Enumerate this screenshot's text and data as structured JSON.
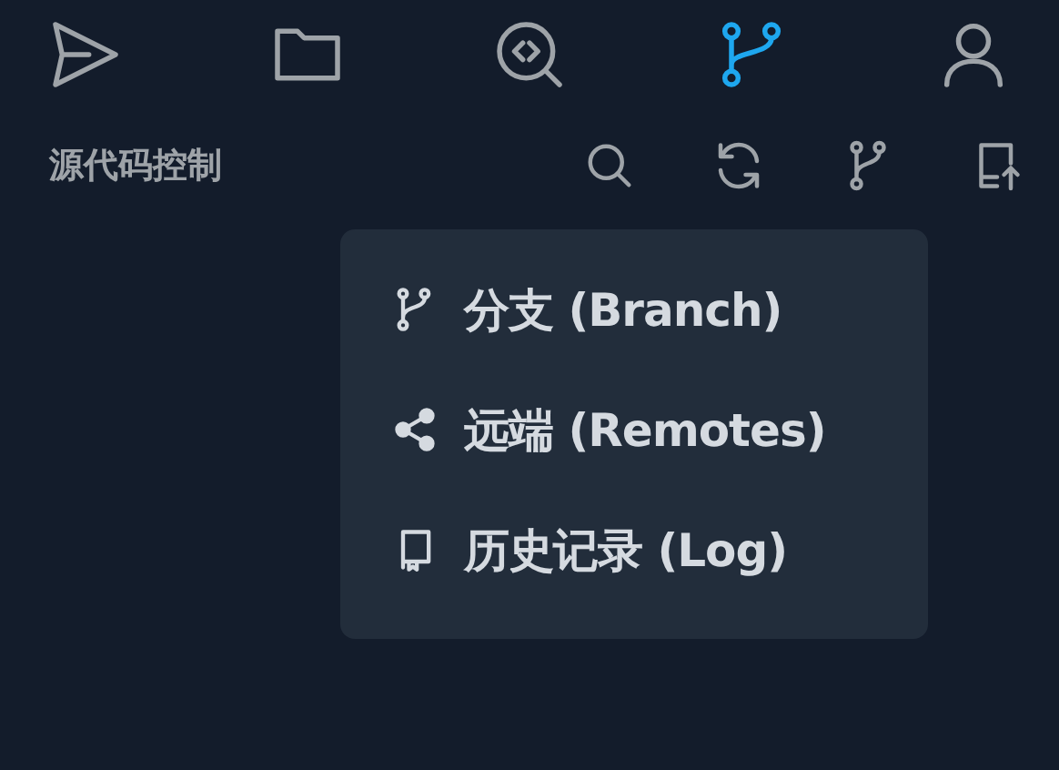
{
  "nav": [
    {
      "kind": "send",
      "selected": false
    },
    {
      "kind": "folder",
      "selected": false
    },
    {
      "kind": "code-search",
      "selected": false
    },
    {
      "kind": "branch",
      "selected": true
    },
    {
      "kind": "user",
      "selected": false
    }
  ],
  "panel": {
    "title": "源代码控制",
    "actions": [
      {
        "kind": "search"
      },
      {
        "kind": "refresh"
      },
      {
        "kind": "branch"
      },
      {
        "kind": "upload"
      }
    ]
  },
  "menu": [
    {
      "kind": "branch",
      "label": "分支 (Branch)"
    },
    {
      "kind": "share",
      "label": "远端 (Remotes)"
    },
    {
      "kind": "book",
      "label": "历史记录 (Log)"
    }
  ]
}
